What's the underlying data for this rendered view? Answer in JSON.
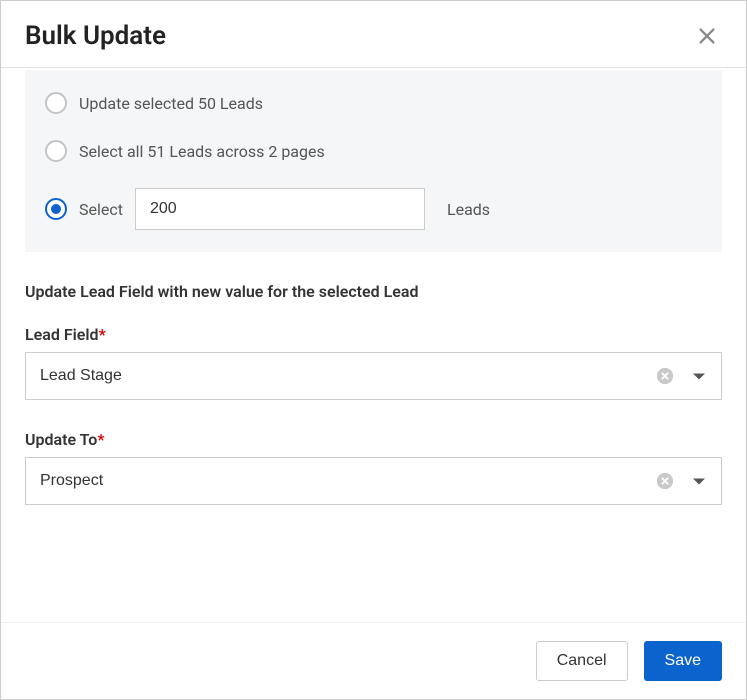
{
  "header": {
    "title": "Bulk Update"
  },
  "selection": {
    "option1": "Update selected 50 Leads",
    "option2": "Select all 51 Leads across 2 pages",
    "option3_prefix": "Select",
    "option3_value": "200",
    "option3_suffix": "Leads"
  },
  "instruction": "Update Lead Field with new value for the selected Lead",
  "fields": {
    "lead_field": {
      "label": "Lead Field",
      "required": "*",
      "value": "Lead Stage"
    },
    "update_to": {
      "label": "Update To",
      "required": "*",
      "value": "Prospect"
    }
  },
  "footer": {
    "cancel": "Cancel",
    "save": "Save"
  }
}
